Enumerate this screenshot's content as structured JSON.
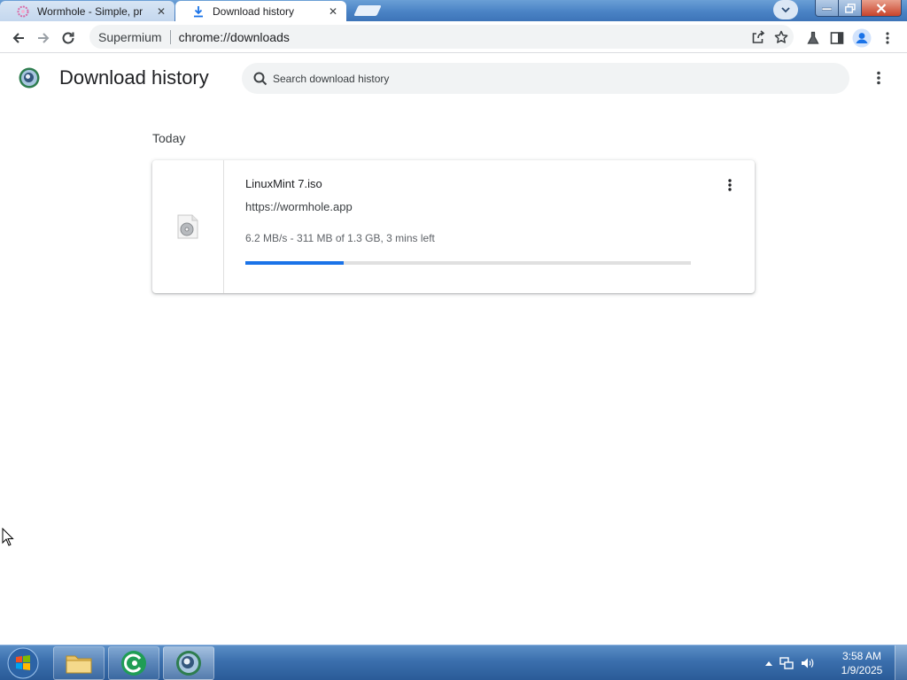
{
  "tabs": [
    {
      "label": "Wormhole - Simple, pr",
      "icon": "wormhole-favicon",
      "active": false
    },
    {
      "label": "Download history",
      "icon": "download-icon",
      "active": true
    }
  ],
  "omnibox": {
    "site": "Supermium",
    "url": "chrome://downloads"
  },
  "page": {
    "title": "Download history",
    "search_placeholder": "Search download history",
    "section": "Today"
  },
  "downloads": [
    {
      "filename": "LinuxMint 7.iso",
      "url": "https://wormhole.app",
      "status": "6.2 MB/s - 311 MB of 1.3 GB, 3 mins left",
      "progress": 0.22
    }
  ],
  "taskbar": {
    "apps": [
      "folder-icon",
      "wormhole-app-icon",
      "supermium-icon"
    ],
    "time": "3:58 AM",
    "date": "1/9/2025"
  },
  "colors": {
    "accent": "#1a73e8",
    "title_bar": "#4a83c5",
    "taskbar": "#3b6fad"
  }
}
